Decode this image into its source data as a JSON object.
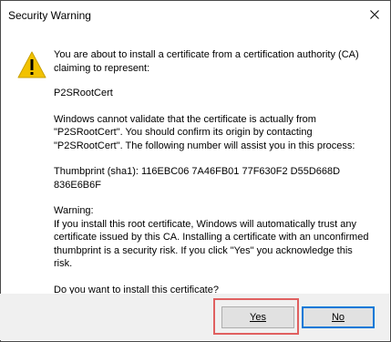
{
  "window": {
    "title": "Security Warning",
    "close_icon": "close-icon"
  },
  "message": {
    "icon": "warning-icon",
    "icon_color": "#f2c200",
    "intro": "You are about to install a certificate from a certification authority (CA) claiming to represent:",
    "ca_name": "P2SRootCert",
    "validation_line1": "Windows cannot validate that the certificate is actually from",
    "validation_line2": "\"P2SRootCert\". You should confirm its origin by contacting",
    "validation_line3": "\"P2SRootCert\". The following number will assist you in this process:",
    "thumbprint": "Thumbprint (sha1): 116EBC06 7A46FB01 77F630F2 D55D668D 836E6B6F",
    "warning_heading": "Warning:",
    "warning_line1": "If you install this root certificate, Windows will automatically trust any",
    "warning_line2": "certificate issued by this CA. Installing a certificate with an unconfirmed",
    "warning_line3": "thumbprint is a security risk. If you click \"Yes\" you acknowledge this",
    "warning_line4": "risk.",
    "question": "Do you want to install this certificate?"
  },
  "buttons": {
    "yes_label": "Yes",
    "no_label": "No"
  },
  "colors": {
    "highlight": "#e06060",
    "default_button_border": "#0078d7"
  }
}
